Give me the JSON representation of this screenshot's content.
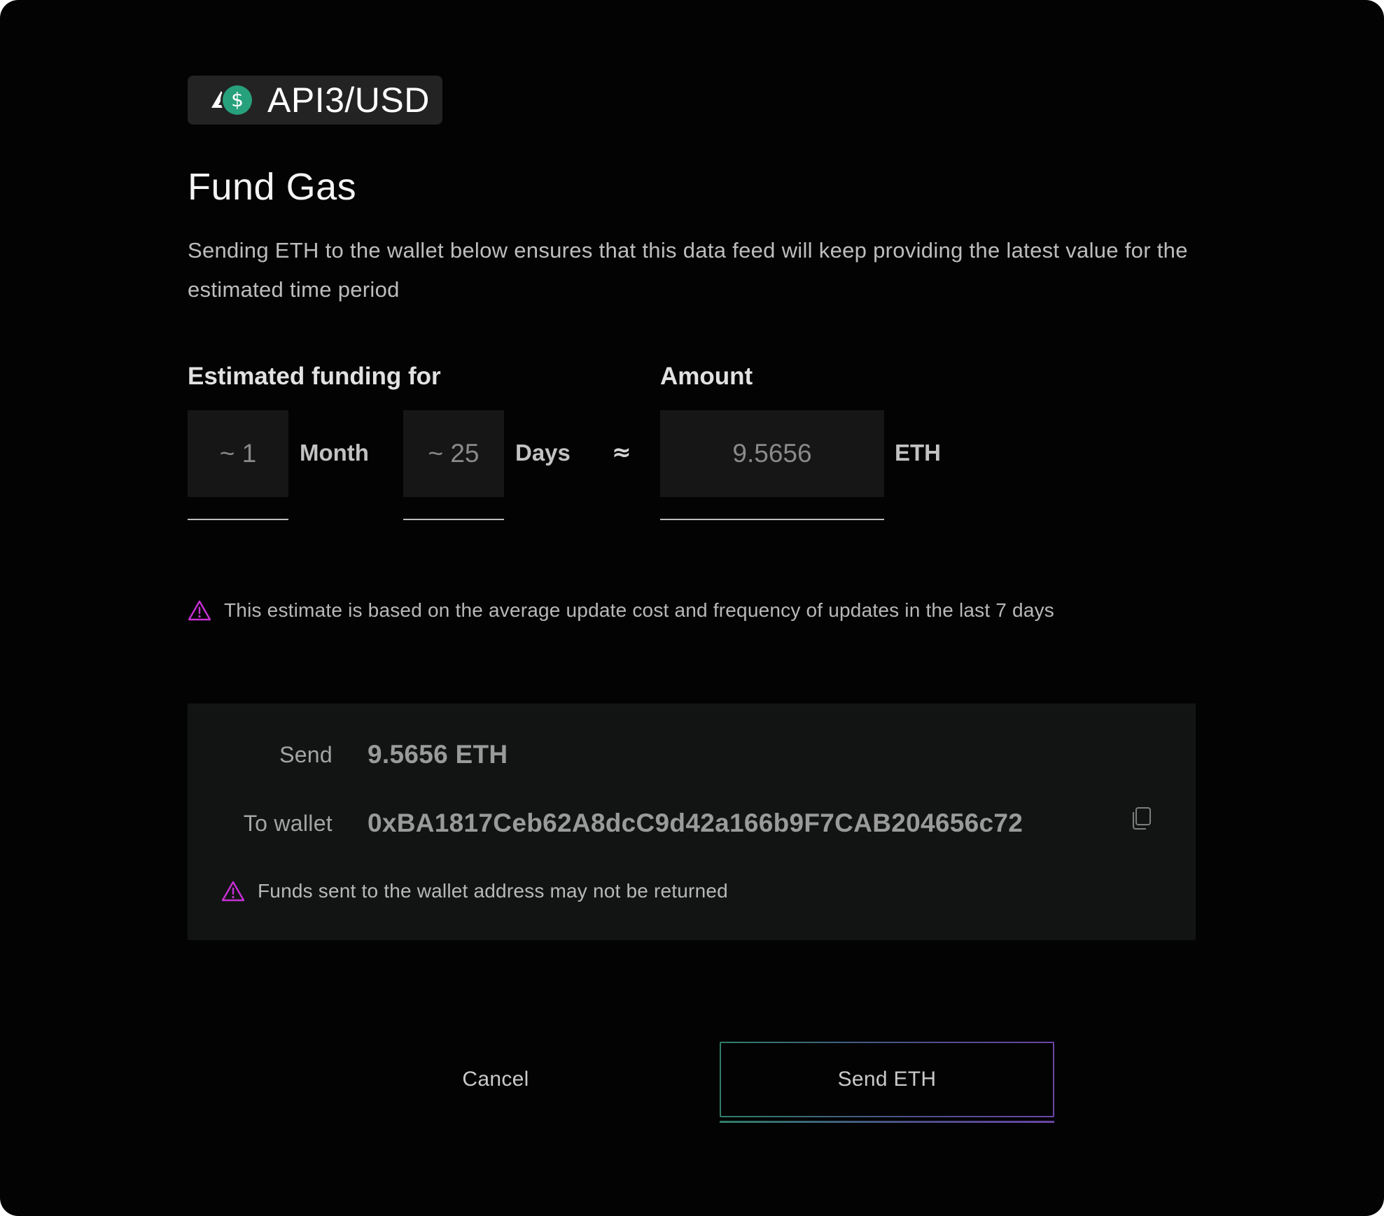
{
  "pair": {
    "name": "API3/USD",
    "icons": [
      "api3-logo-icon",
      "usd-coin-icon"
    ],
    "usd_symbol": "$"
  },
  "modal": {
    "title": "Fund Gas",
    "description": "Sending ETH to the wallet below ensures that this data feed will keep providing the latest value for the estimated time period"
  },
  "estimate": {
    "label": "Estimated funding for",
    "months_value": "~ 1",
    "months_unit": "Month",
    "days_value": "~ 25",
    "days_unit": "Days",
    "approx_symbol": "≈"
  },
  "amount": {
    "label": "Amount",
    "value": "9.5656",
    "unit": "ETH"
  },
  "estimate_warning": "This estimate is based on the average update cost and frequency of updates in the last 7 days",
  "send_summary": {
    "send_label": "Send",
    "send_value": "9.5656 ETH",
    "wallet_label": "To wallet",
    "wallet_address": "0xBA1817Ceb62A8dcC9d42a166b9F7CAB204656c72",
    "warning": "Funds sent to the wallet address may not be returned"
  },
  "actions": {
    "cancel_label": "Cancel",
    "send_label": "Send ETH"
  },
  "colors": {
    "background": "#030303",
    "panel": "#121414",
    "field": "#161616",
    "warning_accent": "#c930d6",
    "usd_green": "#27a17b",
    "button_gradient_start": "#2f7e69",
    "button_gradient_end": "#6a45a6"
  }
}
